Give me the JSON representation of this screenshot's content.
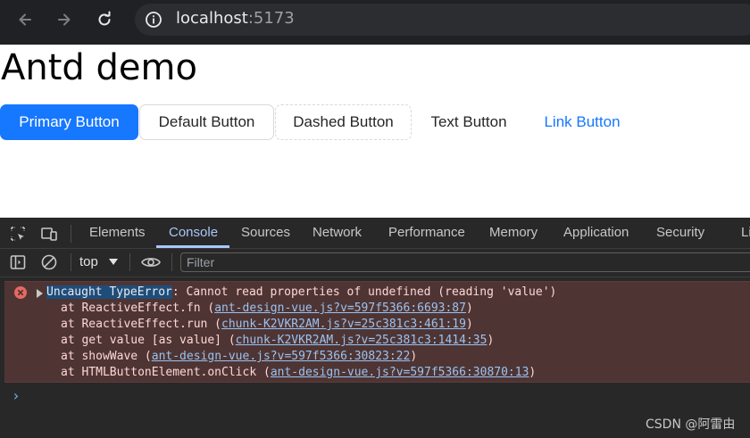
{
  "browser": {
    "url_host": "localhost",
    "url_port": ":5173"
  },
  "page": {
    "title": "Antd demo",
    "buttons": {
      "primary": "Primary Button",
      "default": "Default Button",
      "dashed": "Dashed Button",
      "text": "Text Button",
      "link": "Link Button"
    }
  },
  "devtools": {
    "tabs": [
      "Elements",
      "Console",
      "Sources",
      "Network",
      "Performance",
      "Memory",
      "Application",
      "Security",
      "Li"
    ],
    "active_tab": "Console",
    "context": "top",
    "filter_placeholder": "Filter",
    "error": {
      "type": "Uncaught TypeError",
      "message": ": Cannot read properties of undefined (reading 'value')",
      "stack": [
        {
          "prefix": "at ReactiveEffect.fn (",
          "link": "ant-design-vue.js?v=597f5366:6693:87",
          "suffix": ")"
        },
        {
          "prefix": "at ReactiveEffect.run (",
          "link": "chunk-K2VKR2AM.js?v=25c381c3:461:19",
          "suffix": ")"
        },
        {
          "prefix": "at get value [as value] (",
          "link": "chunk-K2VKR2AM.js?v=25c381c3:1414:35",
          "suffix": ")"
        },
        {
          "prefix": "at showWave (",
          "link": "ant-design-vue.js?v=597f5366:30823:22",
          "suffix": ")"
        },
        {
          "prefix": "at HTMLButtonElement.onClick (",
          "link": "ant-design-vue.js?v=597f5366:30870:13",
          "suffix": ")"
        }
      ]
    },
    "prompt": "›"
  },
  "watermark": "CSDN @阿雷由",
  "colors": {
    "primary": "#1677ff",
    "error_bg": "#4e3534",
    "active_tab": "#a8c7fa"
  }
}
